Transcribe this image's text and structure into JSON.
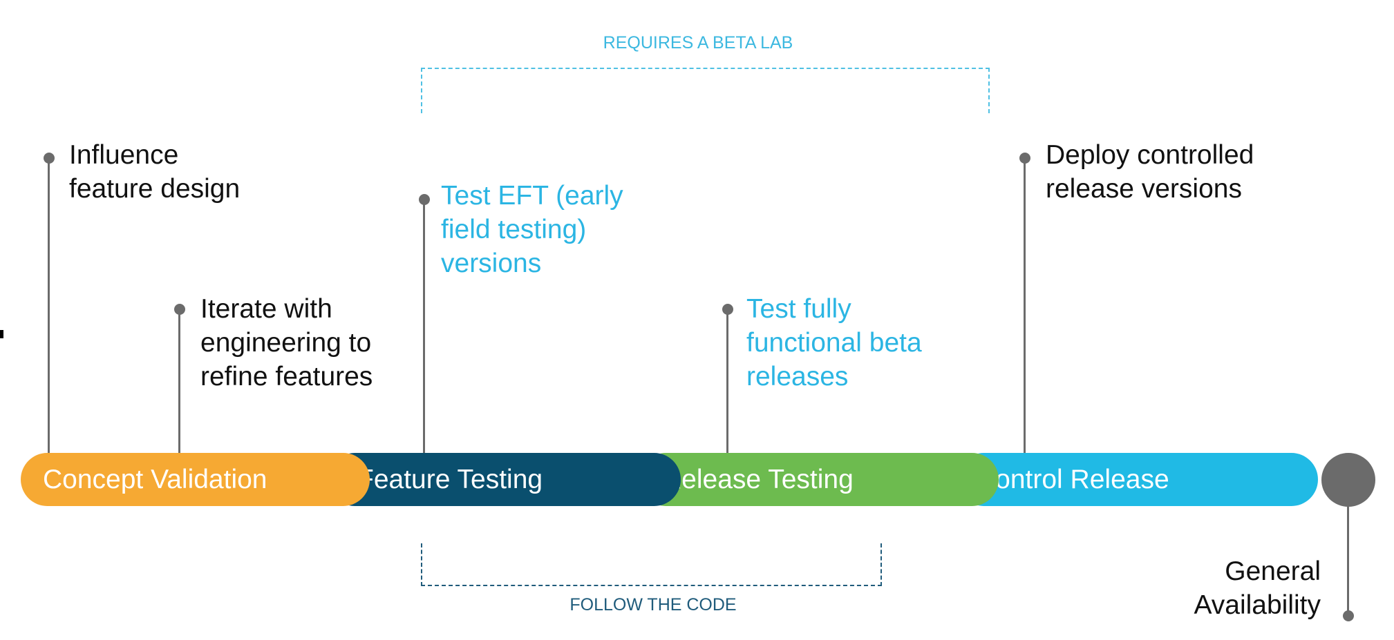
{
  "top_bracket": {
    "label": "REQUIRES A BETA LAB",
    "color": "#4FC0E3"
  },
  "bottom_bracket": {
    "label": "FOLLOW THE CODE",
    "color": "#1F5B7B"
  },
  "phases": [
    {
      "label": "Concept Validation",
      "color": "#F6A933"
    },
    {
      "label": "Feature Testing",
      "color": "#0A4F6E"
    },
    {
      "label": "Release Testing",
      "color": "#6DBB4F"
    },
    {
      "label": "Control Release",
      "color": "#20BAE5"
    }
  ],
  "milestone": {
    "label_line1": "General",
    "label_line2": "Availability",
    "color": "#6B6B6B"
  },
  "notes": [
    {
      "lines": [
        "Influence",
        "feature design"
      ],
      "highlight": false
    },
    {
      "lines": [
        "Iterate with",
        "engineering to",
        "refine features"
      ],
      "highlight": false
    },
    {
      "lines": [
        "Test EFT (early",
        "field testing)",
        "versions"
      ],
      "highlight": true
    },
    {
      "lines": [
        "Test fully",
        "functional beta",
        "releases"
      ],
      "highlight": true
    },
    {
      "lines": [
        "Deploy controlled",
        "release versions"
      ],
      "highlight": false
    }
  ]
}
